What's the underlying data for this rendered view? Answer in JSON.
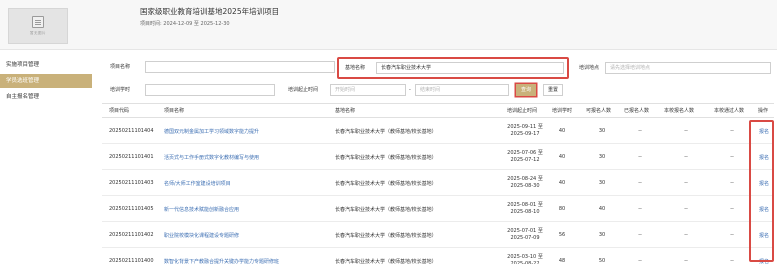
{
  "header": {
    "thumb_caption": "暂无图片",
    "title": "国家级职业教育培训基地2025年培训项目",
    "time_label": "项目时间:",
    "time_range": "2024-12-09 至 2025-12-30"
  },
  "sidebar": {
    "items": [
      {
        "label": "实施项目管理"
      },
      {
        "label": "学员选班管理"
      },
      {
        "label": "自主报名管理"
      }
    ]
  },
  "filters": {
    "project_name_label": "项目名称",
    "project_name_value": "",
    "base_name_label": "基地名称",
    "base_name_value": "长春汽车职业技术大学",
    "location_label": "培训地点",
    "location_placeholder": "请先选择培训地点",
    "hours_label": "培训学时",
    "hours_value": "",
    "period_label": "培训起止时间",
    "start_placeholder": "开始时间",
    "separator": "-",
    "end_placeholder": "结束时间",
    "search_btn": "查询",
    "reset_btn": "重置"
  },
  "table": {
    "columns": [
      "项目代码",
      "项目名称",
      "基地名称",
      "培训起止时间",
      "培训学时",
      "可报名人数",
      "已报名人数",
      "本校报名人数",
      "本校通过人数",
      "操作"
    ],
    "rows": [
      {
        "code": "20250211101404",
        "name": "德国双元制金属加工学习领域数字能力提升",
        "base": "长春汽车职业技术大学（教师基地/校长基地）",
        "start": "2025-09-11 至",
        "end": "2025-09-17",
        "hours": "40",
        "capacity": "30",
        "enrolled": "--",
        "school_enrolled": "--",
        "school_passed": "--",
        "action": "报名"
      },
      {
        "code": "20250211101401",
        "name": "活页式与工作手册式数字化教材编写与使用",
        "base": "长春汽车职业技术大学（教师基地/校长基地）",
        "start": "2025-07-06 至",
        "end": "2025-07-12",
        "hours": "40",
        "capacity": "30",
        "enrolled": "--",
        "school_enrolled": "--",
        "school_passed": "--",
        "action": "报名"
      },
      {
        "code": "20250211101403",
        "name": "名师/大师工作室建设培训项目",
        "base": "长春汽车职业技术大学（教师基地/校长基地）",
        "start": "2025-08-24 至",
        "end": "2025-08-30",
        "hours": "40",
        "capacity": "30",
        "enrolled": "--",
        "school_enrolled": "--",
        "school_passed": "--",
        "action": "报名"
      },
      {
        "code": "20250211101405",
        "name": "新一代信息技术赋能创新融合应用",
        "base": "长春汽车职业技术大学（教师基地/校长基地）",
        "start": "2025-08-01 至",
        "end": "2025-08-10",
        "hours": "80",
        "capacity": "40",
        "enrolled": "--",
        "school_enrolled": "--",
        "school_passed": "--",
        "action": "报名"
      },
      {
        "code": "20250211101402",
        "name": "职业院校模块化课程建设专题研修",
        "base": "长春汽车职业技术大学（教师基地/校长基地）",
        "start": "2025-07-01 至",
        "end": "2025-07-09",
        "hours": "56",
        "capacity": "30",
        "enrolled": "--",
        "school_enrolled": "--",
        "school_passed": "--",
        "action": "报名"
      },
      {
        "code": "20250211101400",
        "name": "数智化背景下产教融合提升关键办学能力专题研修班",
        "base": "长春汽车职业技术大学（教师基地/校长基地）",
        "start": "2025-03-10 至",
        "end": "2025-08-22",
        "hours": "48",
        "capacity": "50",
        "enrolled": "--",
        "school_enrolled": "--",
        "school_passed": "--",
        "action": "报名"
      }
    ]
  },
  "colors": {
    "accent": "#c9b17a",
    "link": "#3d6fb3",
    "highlight_border": "#d94a44"
  }
}
